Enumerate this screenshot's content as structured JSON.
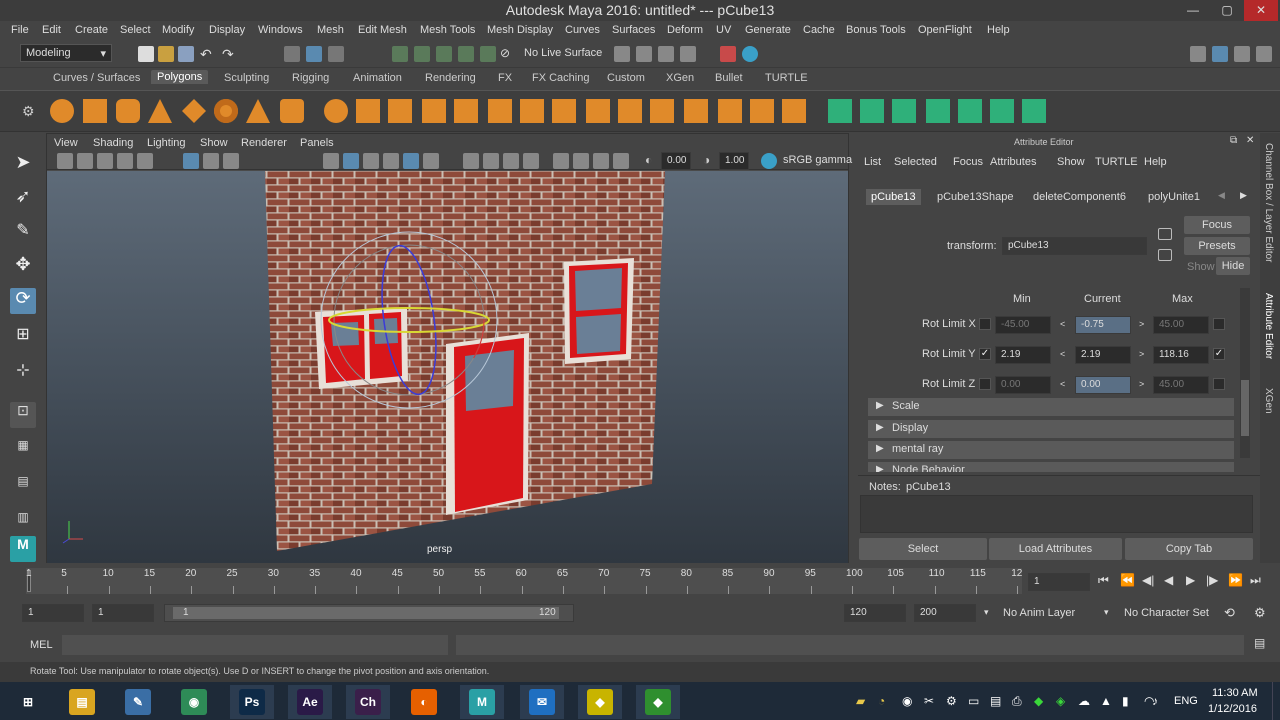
{
  "window": {
    "title": "Autodesk Maya 2016: untitled*   ---    pCube13",
    "min": "—",
    "max": "▢",
    "close": "✕"
  },
  "menus": [
    "File",
    "Edit",
    "Create",
    "Select",
    "Modify",
    "Display",
    "Windows",
    "Mesh",
    "Edit Mesh",
    "Mesh Tools",
    "Mesh Display",
    "Curves",
    "Surfaces",
    "Deform",
    "UV",
    "Generate",
    "Cache",
    "Bonus Tools",
    "OpenFlight",
    "Help"
  ],
  "status": {
    "mode": "Modeling",
    "live_surface": "No Live Surface"
  },
  "shelf_tabs": [
    "Curves / Surfaces",
    "Polygons",
    "Sculpting",
    "Rigging",
    "Animation",
    "Rendering",
    "FX",
    "FX Caching",
    "Custom",
    "XGen",
    "Bullet",
    "TURTLE"
  ],
  "viewport": {
    "menus": [
      "View",
      "Shading",
      "Lighting",
      "Show",
      "Renderer",
      "Panels"
    ],
    "exposure": "0.00",
    "gamma": "1.00",
    "color_space": "sRGB gamma",
    "camera": "persp"
  },
  "attr_editor": {
    "title": "Attribute Editor",
    "menus": [
      "List",
      "Selected",
      "Focus",
      "Attributes",
      "Show",
      "TURTLE",
      "Help"
    ],
    "node_tabs": [
      "pCube13",
      "pCube13Shape",
      "deleteComponent6",
      "polyUnite1"
    ],
    "transform_label": "transform:",
    "transform_value": "pCube13",
    "focus": "Focus",
    "presets": "Presets",
    "show": "Show",
    "hide": "Hide",
    "col_min": "Min",
    "col_current": "Current",
    "col_max": "Max",
    "rot_limits": [
      {
        "label": "Rot Limit X",
        "min_on": false,
        "min": "-45.00",
        "current": "-0.75",
        "max": "45.00",
        "max_on": false
      },
      {
        "label": "Rot Limit Y",
        "min_on": true,
        "min": "2.19",
        "current": "2.19",
        "max": "118.16",
        "max_on": true
      },
      {
        "label": "Rot Limit Z",
        "min_on": false,
        "min": "0.00",
        "current": "0.00",
        "max": "45.00",
        "max_on": false
      }
    ],
    "sections": [
      "Scale",
      "Display",
      "mental ray",
      "Node Behavior"
    ],
    "notes_label": "Notes:",
    "notes_value": "pCube13",
    "buttons": [
      "Select",
      "Load Attributes",
      "Copy Tab"
    ],
    "side_tabs": [
      "Channel Box / Layer Editor",
      "Attribute Editor",
      "XGen"
    ]
  },
  "timeline": {
    "ticks": [
      "5",
      "10",
      "15",
      "20",
      "25",
      "30",
      "35",
      "40",
      "45",
      "50",
      "55",
      "60",
      "65",
      "70",
      "75",
      "80",
      "85",
      "90",
      "95",
      "100",
      "105",
      "110",
      "115",
      "12"
    ],
    "first": "1",
    "current_frame": "1"
  },
  "range": {
    "start": "1",
    "start2": "1",
    "slider_start": "1",
    "slider_end": "120",
    "end": "120",
    "end2": "200",
    "anim_layer": "No Anim Layer",
    "char_set": "No Character Set"
  },
  "cmd": {
    "label": "MEL"
  },
  "help": "Rotate Tool: Use manipulator to rotate object(s). Use D or INSERT to change the pivot position and axis orientation.",
  "taskbar": {
    "lang": "ENG",
    "time": "11:30 AM",
    "date": "1/12/2016",
    "apps": [
      {
        "name": "windows-start",
        "label": "⊞",
        "color": "#1e2a38"
      },
      {
        "name": "file-explorer",
        "label": "▤",
        "color": "#d9a520"
      },
      {
        "name": "paint-app",
        "label": "✎",
        "color": "#3a6ea5"
      },
      {
        "name": "camera-app",
        "label": "◉",
        "color": "#2e8b57"
      },
      {
        "name": "photoshop",
        "label": "Ps",
        "color": "#0e2a47"
      },
      {
        "name": "after-effects",
        "label": "Ae",
        "color": "#2a1a47"
      },
      {
        "name": "character-animator",
        "label": "Ch",
        "color": "#3a1f4a"
      },
      {
        "name": "firefox",
        "label": "◐",
        "color": "#e66000"
      },
      {
        "name": "maya",
        "label": "M",
        "color": "#2aa0a5"
      },
      {
        "name": "mail",
        "label": "✉",
        "color": "#1f6fc1"
      },
      {
        "name": "app-yellow",
        "label": "◆",
        "color": "#c8b400"
      },
      {
        "name": "app-green",
        "label": "◆",
        "color": "#2f8f2f"
      }
    ]
  },
  "colors": {
    "accent": "#5a6f85",
    "wall": "#8e4a3a",
    "door": "#d8161a",
    "maya_blue": "#2aa0a5"
  }
}
